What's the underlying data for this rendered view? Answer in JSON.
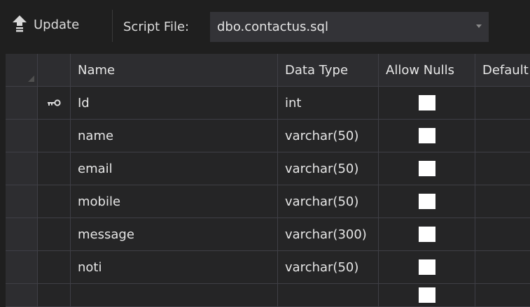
{
  "toolbar": {
    "update_label": "Update",
    "script_file_label": "Script File:",
    "script_file_value": "dbo.contactus.sql"
  },
  "columns": {
    "name": "Name",
    "data_type": "Data Type",
    "allow_nulls": "Allow Nulls",
    "default": "Default"
  },
  "rows": [
    {
      "name": "Id",
      "type": "int",
      "primary_key": true,
      "allow_nulls": false,
      "default": ""
    },
    {
      "name": "name",
      "type": "varchar(50)",
      "primary_key": false,
      "allow_nulls": false,
      "default": ""
    },
    {
      "name": "email",
      "type": "varchar(50)",
      "primary_key": false,
      "allow_nulls": false,
      "default": ""
    },
    {
      "name": "mobile",
      "type": "varchar(50)",
      "primary_key": false,
      "allow_nulls": false,
      "default": ""
    },
    {
      "name": "message",
      "type": "varchar(300)",
      "primary_key": false,
      "allow_nulls": false,
      "default": ""
    },
    {
      "name": "noti",
      "type": "varchar(50)",
      "primary_key": false,
      "allow_nulls": false,
      "default": ""
    },
    {
      "name": "",
      "type": "",
      "primary_key": false,
      "allow_nulls": false,
      "default": ""
    }
  ],
  "icons": {
    "update": "upload-arrow-icon",
    "primary_key": "key-icon",
    "dropdown": "chevron-down-icon"
  },
  "colors": {
    "background": "#1f1f1f",
    "grid_background": "#252526",
    "header_background": "#2d2d30",
    "gridline": "#3f3f46",
    "text": "#e6e6e6",
    "checkbox": "#ffffff"
  }
}
